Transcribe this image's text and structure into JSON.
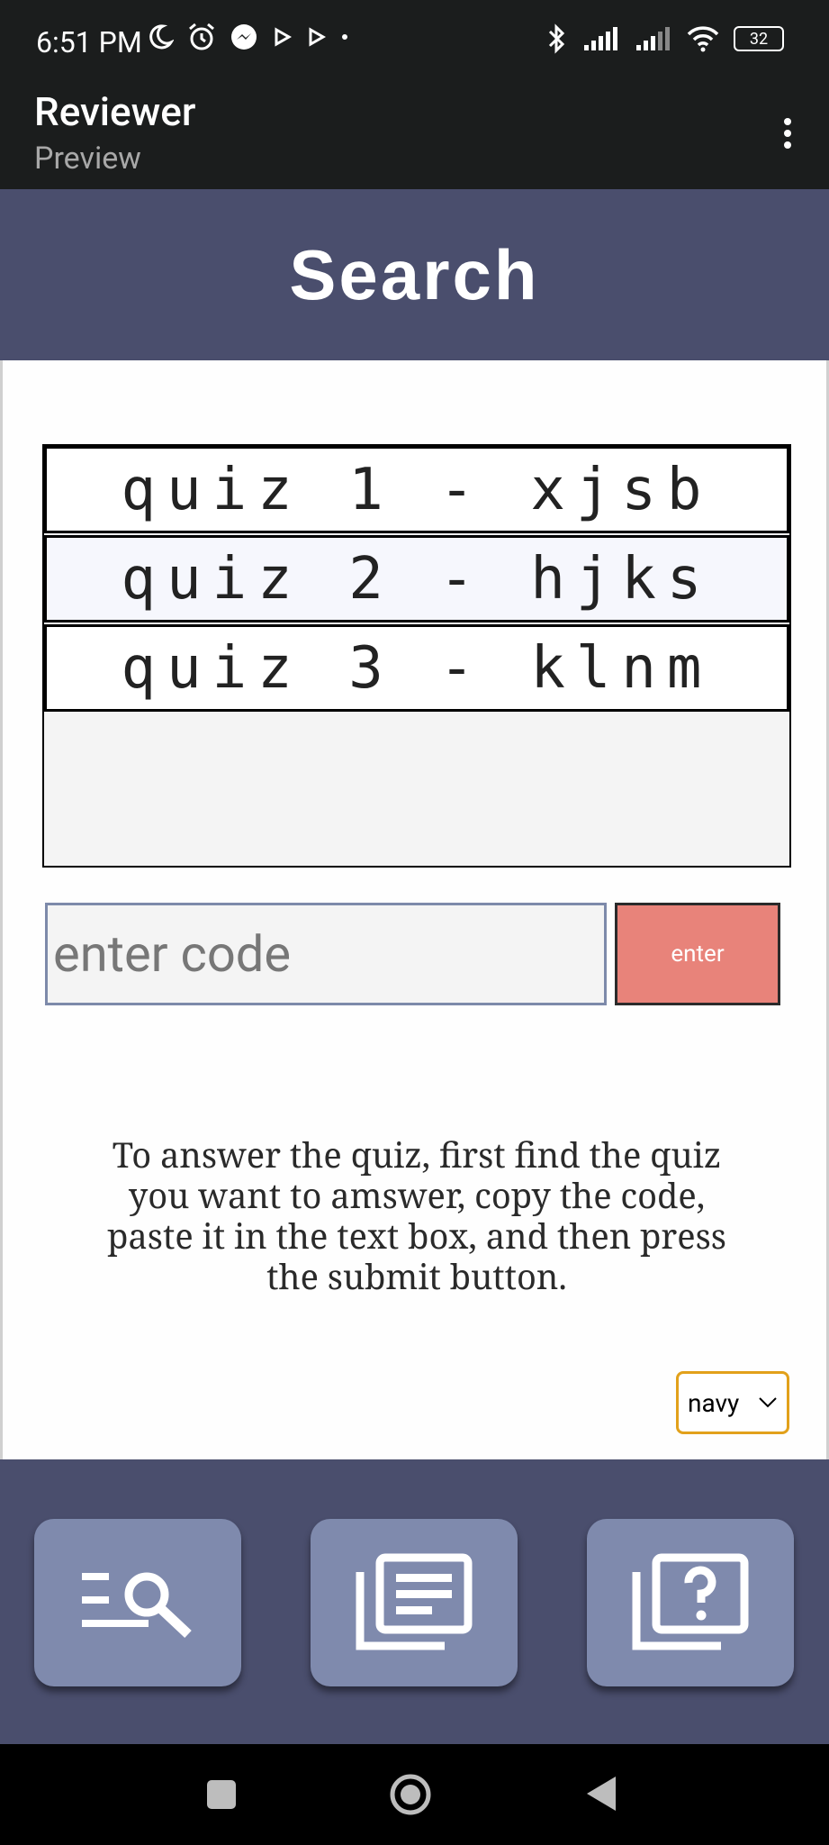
{
  "status_bar": {
    "time": "6:51 PM",
    "battery": "32"
  },
  "app_bar": {
    "title": "Reviewer",
    "subtitle": "Preview"
  },
  "header": {
    "title": "Search"
  },
  "quiz_list": [
    {
      "label": "quiz 1 - xjsb"
    },
    {
      "label": "quiz 2 - hjks"
    },
    {
      "label": "quiz 3 - klnm"
    }
  ],
  "code_entry": {
    "placeholder": "enter code",
    "value": "",
    "button_label": "enter"
  },
  "instructions": "To answer the quiz, first find the quiz you want to amswer, copy the code, paste it in the text box, and then press the submit button.",
  "theme_select": {
    "selected": "navy"
  },
  "bottom_nav": [
    {
      "icon": "search-list-icon"
    },
    {
      "icon": "document-stack-icon"
    },
    {
      "icon": "question-stack-icon"
    }
  ],
  "colors": {
    "header_bg": "#4a4e6d",
    "nav_button": "#7f8aad",
    "enter_button": "#e8837a",
    "select_border": "#e2a11b"
  }
}
